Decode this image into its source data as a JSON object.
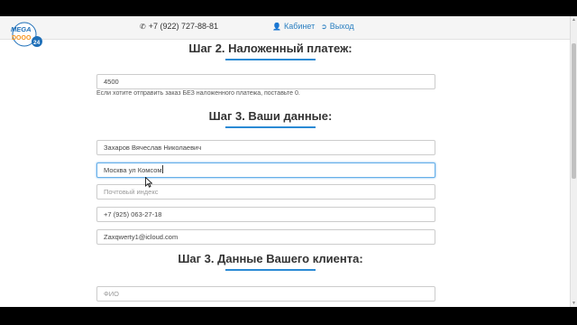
{
  "header": {
    "logo_text": "MEGA DOOO 24",
    "phone": "+7 (922) 727-88-81",
    "cabinet_label": "Кабинет",
    "logout_label": "Выход"
  },
  "step_payment": {
    "title": "Шаг 2. Наложенный платеж:",
    "amount_value": "4500",
    "help_text": "Если хотите отправить заказ БЕЗ наложенного платежа, поставьте 0."
  },
  "step_your_data": {
    "title": "Шаг 3. Ваши данные:",
    "name_value": "Захаров Вячеслав Николаевич",
    "address_value": "Москва ул Комсом",
    "zip_placeholder": "Почтовый индекс",
    "phone_value": "+7 (925) 063-27-18",
    "email_value": "Zaxqwerty1@icloud.com"
  },
  "step_client": {
    "title": "Шаг 3. Данные Вашего клиента:",
    "fio_placeholder": "ФИО"
  },
  "colors": {
    "accent": "#2a8ad4",
    "link": "#2a7fc1",
    "logo_orange": "#f7941d",
    "logo_blue": "#1e6fb8"
  }
}
